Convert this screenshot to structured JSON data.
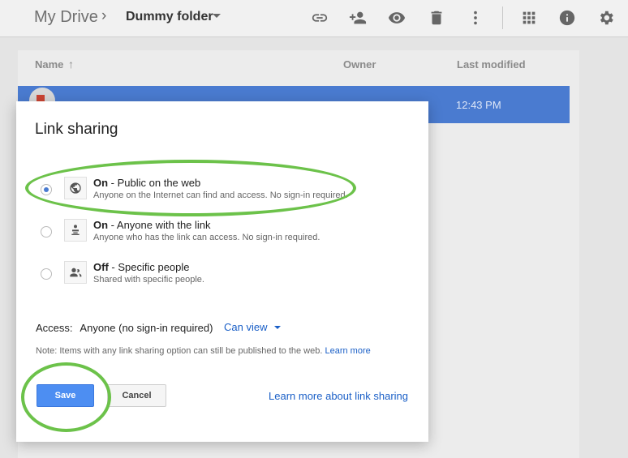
{
  "header": {
    "root": "My Drive",
    "separator": "›",
    "folder": "Dummy folder"
  },
  "toolbar_icons": [
    "link-icon",
    "add-person-icon",
    "preview-eye-icon",
    "trash-icon",
    "more-vert-icon",
    "grid-view-icon",
    "info-icon",
    "settings-gear-icon"
  ],
  "list": {
    "col_name": "Name",
    "sort_arrow": "↑",
    "col_owner": "Owner",
    "col_modified": "Last modified",
    "row_time": "12:43 PM"
  },
  "dialog": {
    "title": "Link sharing",
    "options": [
      {
        "bold": "On",
        "text": " - Public on the web",
        "sub": "Anyone on the Internet can find and access. No sign-in required.",
        "checked": true,
        "icon": "globe-icon"
      },
      {
        "bold": "On",
        "text": " - Anyone with the link",
        "sub": "Anyone who has the link can access. No sign-in required.",
        "checked": false,
        "icon": "link-person-icon"
      },
      {
        "bold": "Off",
        "text": " - Specific people",
        "sub": "Shared with specific people.",
        "checked": false,
        "icon": "people-icon"
      }
    ],
    "access_label": "Access:",
    "access_value": "Anyone (no sign-in required)",
    "access_permission": "Can view",
    "note": "Note: Items with any link sharing option can still be published to the web.",
    "note_link": "Learn more",
    "save": "Save",
    "cancel": "Cancel",
    "learn_more": "Learn more about link sharing"
  },
  "colors": {
    "accent": "#4d8ef2",
    "link": "#1a5fc7",
    "annotation": "#6cc24a",
    "selected_row": "#4a7bd0"
  }
}
